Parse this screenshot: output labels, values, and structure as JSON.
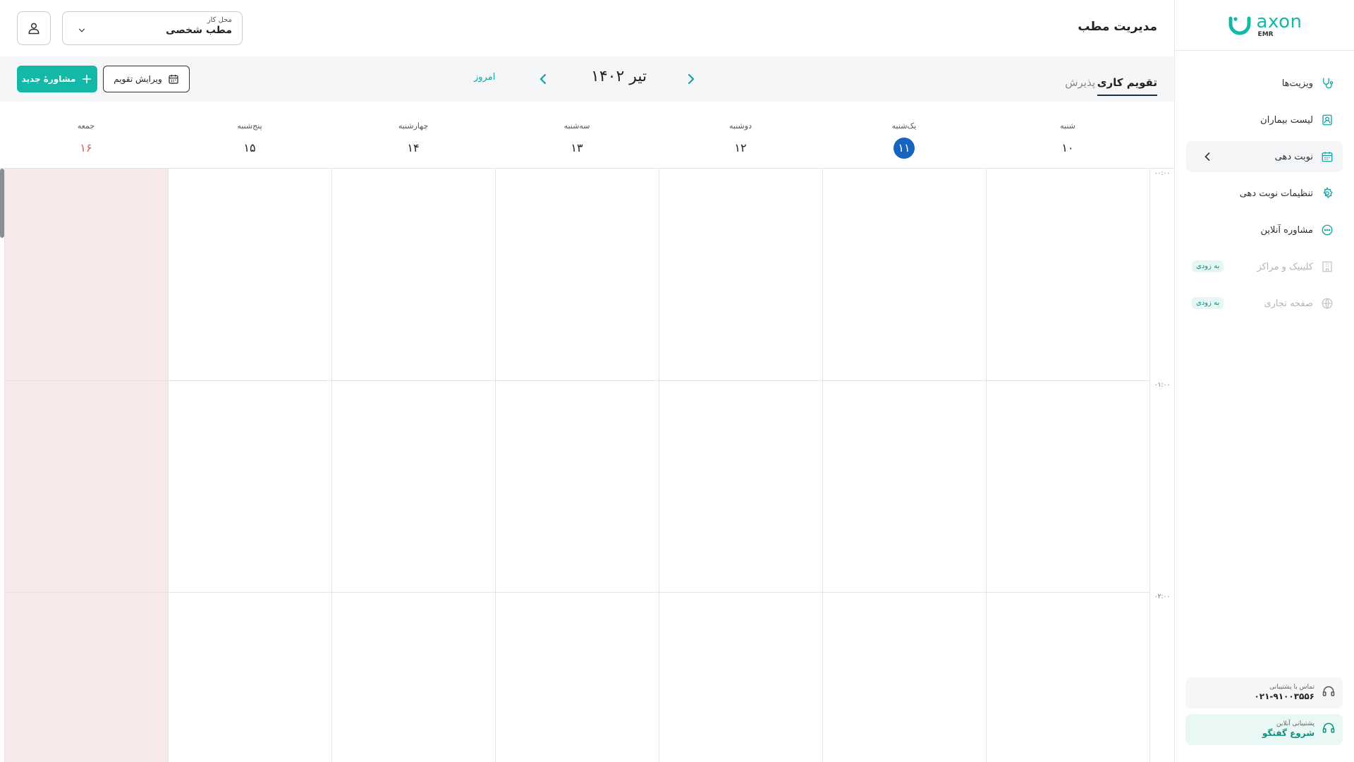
{
  "sidebar": {
    "logo": {
      "name": "axon",
      "sub": "EMR"
    },
    "items": [
      {
        "label": "ویزیت‌ها",
        "icon": "stethoscope-icon"
      },
      {
        "label": "لیست بیماران",
        "icon": "patient-list-icon"
      },
      {
        "label": "نوبت دهی",
        "icon": "calendar-icon"
      },
      {
        "label": "تنظیمات نوبت دهی",
        "icon": "gear-icon"
      },
      {
        "label": "مشاوره آنلاین",
        "icon": "chat-icon"
      },
      {
        "label": "کلینیک و مراکز",
        "icon": "building-icon",
        "badge": "به زودی"
      },
      {
        "label": "صفحه تجاری",
        "icon": "globe-icon",
        "badge": "به زودی"
      }
    ],
    "support_phone": {
      "title": "تماس با پشتیبانی",
      "value": "۰۲۱-۹۱۰۰۳۵۵۶"
    },
    "support_chat": {
      "title": "پشتیبانی آنلاین",
      "value": "شروع گفتگو"
    }
  },
  "header": {
    "title": "مدیریت مطب",
    "workplace_label": "محل کار",
    "workplace_value": "مطب شخصی"
  },
  "toolbar": {
    "tab_calendar": "تقویم کاری",
    "tab_reception": "پذیرش",
    "month": "تیر ۱۴۰۲",
    "today": "امروز",
    "edit_calendar": "ویرایش تقویم",
    "new_consultation": "مشاورهٔ جدید"
  },
  "days": [
    {
      "name": "شنبه",
      "num": "۱۰"
    },
    {
      "name": "یک‌شنبه",
      "num": "۱۱"
    },
    {
      "name": "دوشنبه",
      "num": "۱۲"
    },
    {
      "name": "سه‌شنبه",
      "num": "۱۳"
    },
    {
      "name": "چهارشنبه",
      "num": "۱۴"
    },
    {
      "name": "پنج‌شنبه",
      "num": "۱۵"
    },
    {
      "name": "جمعه",
      "num": "۱۶"
    }
  ],
  "times": [
    "۰۰:۰۰",
    "۰۱:۰۰",
    "۰۲:۰۰"
  ],
  "colors": {
    "accent": "#14b8a6",
    "today": "#1565c0",
    "holiday": "#e05a5a"
  }
}
